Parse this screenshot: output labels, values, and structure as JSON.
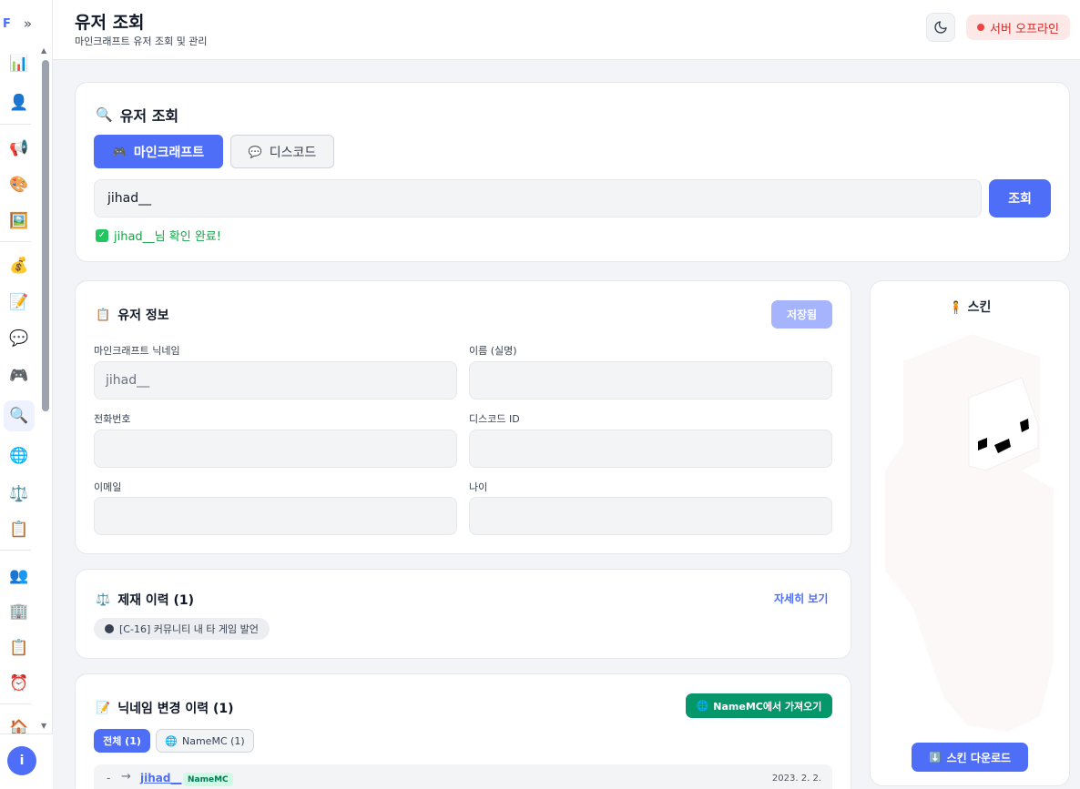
{
  "sidebar": {
    "logo": "F",
    "collapse": "»",
    "items": [
      {
        "icon": "📊",
        "name": "sidebar-item-dashboard"
      },
      {
        "icon": "👤",
        "name": "sidebar-item-user"
      },
      {
        "icon": "📢",
        "name": "sidebar-item-announce"
      },
      {
        "icon": "🎨",
        "name": "sidebar-item-palette"
      },
      {
        "icon": "🖼️",
        "name": "sidebar-item-image"
      },
      {
        "icon": "💰",
        "name": "sidebar-item-money"
      },
      {
        "icon": "📝",
        "name": "sidebar-item-memo"
      },
      {
        "icon": "💬",
        "name": "sidebar-item-chat"
      },
      {
        "icon": "🎮",
        "name": "sidebar-item-game"
      },
      {
        "icon": "🔍",
        "name": "sidebar-item-search"
      },
      {
        "icon": "🌐",
        "name": "sidebar-item-globe"
      },
      {
        "icon": "⚖️",
        "name": "sidebar-item-scale"
      },
      {
        "icon": "📋",
        "name": "sidebar-item-clipboard"
      },
      {
        "icon": "👥",
        "name": "sidebar-item-users"
      },
      {
        "icon": "🏢",
        "name": "sidebar-item-building"
      },
      {
        "icon": "📋",
        "name": "sidebar-item-clipboard-2"
      },
      {
        "icon": "⏰",
        "name": "sidebar-item-alarm"
      },
      {
        "icon": "🏠",
        "name": "sidebar-item-home"
      }
    ],
    "info": "i"
  },
  "header": {
    "title": "유저 조회",
    "subtitle": "마인크래프트 유저 조회 및 관리",
    "server_status": "서버 오프라인"
  },
  "search": {
    "icon": "🔍",
    "title": "유저 조회",
    "tab_minecraft_icon": "🎮",
    "tab_minecraft": "마인크래프트",
    "tab_discord_icon": "💬",
    "tab_discord": "디스코드",
    "value": "jihad__",
    "button": "조회",
    "confirm": "jihad__님 확인 완료!",
    "check": "✓"
  },
  "info": {
    "icon": "📋",
    "title": "유저 정보",
    "saved": "저장됨",
    "fields": [
      {
        "label": "마인크래프트 닉네임",
        "value": "jihad__"
      },
      {
        "label": "이름 (실명)",
        "value": ""
      },
      {
        "label": "전화번호",
        "value": ""
      },
      {
        "label": "디스코드 ID",
        "value": ""
      },
      {
        "label": "이메일",
        "value": ""
      },
      {
        "label": "나이",
        "value": ""
      }
    ]
  },
  "sanctions": {
    "icon": "⚖️",
    "title": "제재 이력 (1)",
    "more": "자세히 보기",
    "items": [
      "[C-16] 커뮤니티 내 타 게임 발언"
    ]
  },
  "nick_history": {
    "icon": "📝",
    "title": "닉네임 변경 이력 (1)",
    "fetch_icon": "🌐",
    "fetch": "NameMC에서 가져오기",
    "filter_all": "전체 (1)",
    "filter_namemc_icon": "🌐",
    "filter_namemc": "NameMC (1)",
    "rows": [
      {
        "from": "-",
        "arrow": "→",
        "to": "jihad__",
        "tag": "NameMC",
        "date": "2023. 2. 2."
      }
    ]
  },
  "skin": {
    "icon": "🧍",
    "title": "스킨",
    "download_icon": "⬇️",
    "download": "스킨 다운로드"
  }
}
